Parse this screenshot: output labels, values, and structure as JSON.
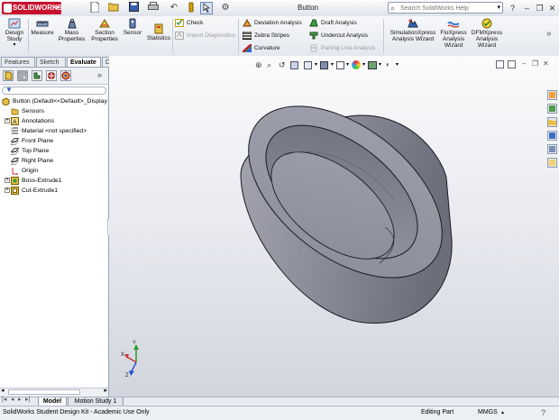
{
  "app": {
    "logo": "SOLIDWORKS",
    "document_title": "Button",
    "search_placeholder": "Search SolidWorks Help"
  },
  "quick_access": [
    "new-icon",
    "open-icon",
    "save-icon",
    "print-icon",
    "undo-icon",
    "rebuild-icon",
    "select-icon",
    "options-icon"
  ],
  "ribbon": {
    "large_tools": [
      {
        "label": "Design\nStudy",
        "icon": "design-study-icon"
      },
      {
        "label": "Measure",
        "icon": "measure-icon"
      },
      {
        "label": "Mass\nProperties",
        "icon": "mass-properties-icon"
      },
      {
        "label": "Section\nProperties",
        "icon": "section-properties-icon"
      },
      {
        "label": "Sensor",
        "icon": "sensor-icon"
      },
      {
        "label": "Statistics",
        "icon": "statistics-icon"
      }
    ],
    "check_group": [
      {
        "label": "Check",
        "enabled": true
      },
      {
        "label": "Import Diagnostics",
        "enabled": false
      }
    ],
    "analysis_col1": [
      {
        "label": "Deviation Analysis",
        "enabled": true
      },
      {
        "label": "Zebra Stripes",
        "enabled": true
      },
      {
        "label": "Curvature",
        "enabled": true
      }
    ],
    "analysis_col2": [
      {
        "label": "Draft Analysis",
        "enabled": true
      },
      {
        "label": "Undercut Analysis",
        "enabled": true
      },
      {
        "label": "Parting Line Analysis",
        "enabled": false
      }
    ],
    "xpress_tools": [
      {
        "label": "SimulationXpress\nAnalysis Wizard",
        "icon": "simulationxpress-icon"
      },
      {
        "label": "FloXpress\nAnalysis\nWizard",
        "icon": "floxpress-icon"
      },
      {
        "label": "DFMXpress\nAnalysis\nWizard",
        "icon": "dfmxpress-icon"
      }
    ]
  },
  "tabs": [
    {
      "label": "Features",
      "active": false
    },
    {
      "label": "Sketch",
      "active": false
    },
    {
      "label": "Evaluate",
      "active": true
    },
    {
      "label": "DimXpert",
      "active": false
    }
  ],
  "feature_tree": {
    "root": "Button  (Default<<Default>_Display",
    "items": [
      {
        "label": "Sensors",
        "icon": "sensors-icon",
        "expandable": false
      },
      {
        "label": "Annotations",
        "icon": "annotations-icon",
        "expandable": true
      },
      {
        "label": "Material <not specified>",
        "icon": "material-icon",
        "expandable": false
      },
      {
        "label": "Front Plane",
        "icon": "plane-icon",
        "expandable": false
      },
      {
        "label": "Top Plane",
        "icon": "plane-icon",
        "expandable": false
      },
      {
        "label": "Right Plane",
        "icon": "plane-icon",
        "expandable": false
      },
      {
        "label": "Origin",
        "icon": "origin-icon",
        "expandable": false
      },
      {
        "label": "Boss-Extrude1",
        "icon": "boss-extrude-icon",
        "expandable": true
      },
      {
        "label": "Cut-Extrude1",
        "icon": "cut-extrude-icon",
        "expandable": true
      }
    ]
  },
  "bottom_tabs": [
    {
      "label": "Model",
      "active": true
    },
    {
      "label": "Motion Study 1",
      "active": false
    }
  ],
  "status": {
    "left": "SolidWorks Student Design Kit - Academic Use Only",
    "mode": "Editing Part",
    "units": "MMGS"
  },
  "colors": {
    "logo_red": "#c8102e",
    "part_face": "#8e8f9c",
    "viewport_top": "#fbfbfc",
    "viewport_bottom": "#d2d5dd"
  }
}
